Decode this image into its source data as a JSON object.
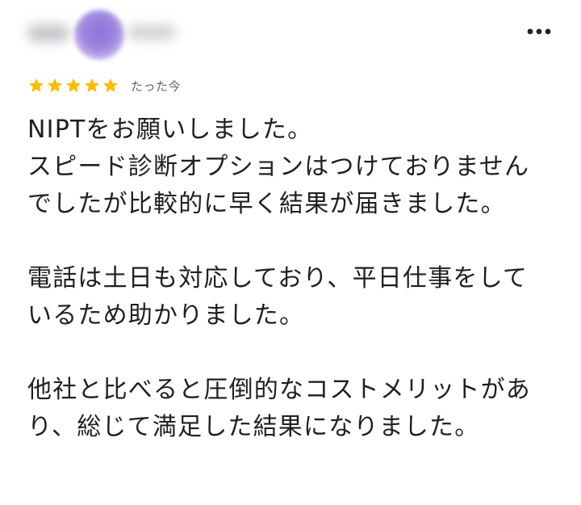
{
  "review": {
    "reviewer": {
      "avatar_color": "#8f74d9"
    },
    "more_icon": "more-horizontal-icon",
    "rating": {
      "stars": 5,
      "max_stars": 5,
      "star_color": "#fbbc04"
    },
    "timestamp": "たった今",
    "body": {
      "paragraph_1": "NIPTをお願いしました。\nスピード診断オプションはつけておりませんでしたが比較的に早く結果が届きました。",
      "paragraph_2": "電話は土日も対応しており、平日仕事をしているため助かりました。",
      "paragraph_3": "他社と比べると圧倒的なコストメリットがあり、総じて満足した結果になりました。"
    }
  }
}
